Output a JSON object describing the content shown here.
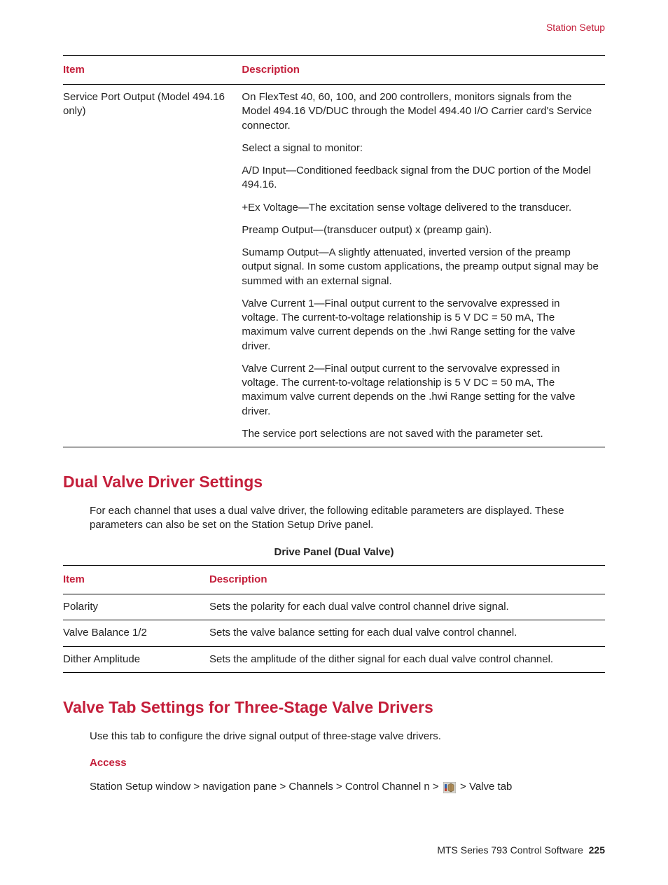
{
  "header": {
    "section": "Station Setup"
  },
  "table1": {
    "headers": {
      "item": "Item",
      "description": "Description"
    },
    "row": {
      "item": "Service Port Output (Model 494.16 only)",
      "paras": [
        "On FlexTest 40, 60, 100, and 200 controllers, monitors signals from the Model 494.16 VD/DUC through the Model 494.40 I/O Carrier card's Service connector.",
        "Select a signal to monitor:",
        "A/D Input—Conditioned feedback signal from the DUC portion of the Model 494.16.",
        "+Ex Voltage—The excitation sense voltage delivered to the transducer.",
        "Preamp Output—(transducer output) x (preamp gain).",
        "Sumamp Output—A slightly attenuated, inverted version of the preamp output signal. In some custom applications, the preamp output signal may be summed with an external signal.",
        "Valve Current 1—Final output current to the servovalve expressed in voltage. The current-to-voltage relationship is 5 V DC = 50 mA, The maximum valve current depends on the .hwi Range setting for the valve driver.",
        "Valve Current 2—Final output current to the servovalve expressed in voltage. The current-to-voltage relationship is 5 V DC = 50 mA, The maximum valve current depends on the .hwi Range setting for the valve driver.",
        "The service port selections are not saved with the parameter set."
      ]
    }
  },
  "section1": {
    "heading": "Dual Valve Driver Settings",
    "intro": "For each channel that uses a dual valve driver, the following editable parameters are displayed. These parameters can also be set on the Station Setup Drive panel.",
    "tableCaption": "Drive Panel (Dual Valve)",
    "table": {
      "headers": {
        "item": "Item",
        "description": "Description"
      },
      "rows": [
        {
          "item": "Polarity",
          "desc": "Sets the polarity for each dual valve control channel drive signal."
        },
        {
          "item": "Valve Balance 1/2",
          "desc": "Sets the valve balance setting for each dual valve control channel."
        },
        {
          "item": "Dither Amplitude",
          "desc": "Sets the amplitude of the dither signal for each dual valve control channel."
        }
      ]
    }
  },
  "section2": {
    "heading": "Valve Tab Settings for Three-Stage Valve Drivers",
    "intro": "Use this tab to configure the drive signal output of three-stage valve drivers.",
    "accessLabel": "Access",
    "breadcrumb": {
      "pre": "Station Setup window > navigation pane > Channels > Control Channel n > ",
      "post": "> Valve tab"
    }
  },
  "footer": {
    "product": "MTS Series 793 Control Software",
    "page": "225"
  }
}
